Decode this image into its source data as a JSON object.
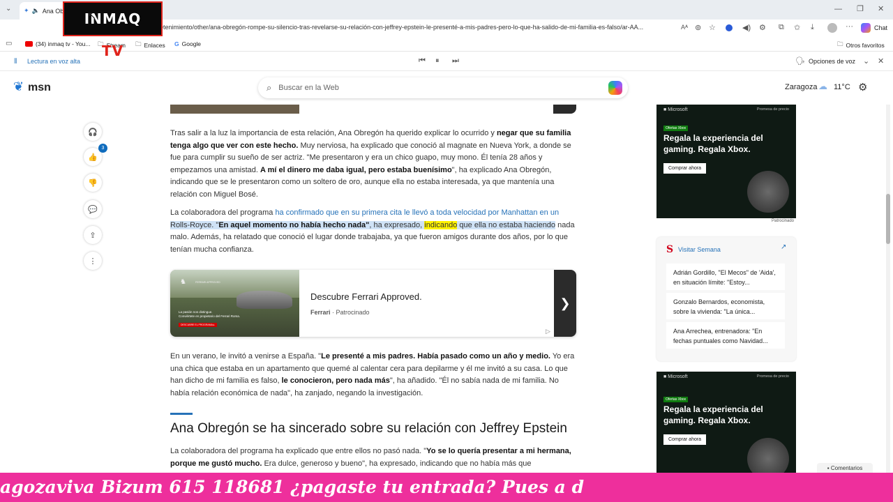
{
  "browser": {
    "tab_title": "Ana Obregón rompe su silencio",
    "url": "msn.com/es-es/entretenimiento/other/ana-obregón-rompe-su-silencio-tras-revelarse-su-relación-con-jeffrey-epstein-le-presenté-a-mis-padres-pero-lo-que-ha-salido-de-mi-familia-es-falso/ar-AA...",
    "chat_label": "Chat",
    "favorites": [
      {
        "icon": "youtube-icon",
        "label": "(34) inmaq tv - You..."
      },
      {
        "icon": "folder-icon",
        "label": "Stream"
      },
      {
        "icon": "folder-icon",
        "label": "Enlaces"
      },
      {
        "icon": "google-icon",
        "label": "Google"
      }
    ],
    "other_favorites": "Otros favoritos"
  },
  "reader": {
    "read_aloud": "Lectura en voz alta",
    "voice_options": "Opciones de voz"
  },
  "msn": {
    "logo": "msn",
    "search_placeholder": "Buscar en la Web",
    "city": "Zaragoza",
    "temp": "11°C"
  },
  "overlay": {
    "logo_a": "INMAQ ",
    "logo_b": "TV",
    "ticker": "agozaviva Bizum 615 118681                           ¿pagaste tu entrada? Pues a d"
  },
  "sidebar": {
    "like_count": "3"
  },
  "article": {
    "p1": [
      {
        "t": "Tras salir a la luz la importancia de esta relación, Ana Obregón ha querido explicar lo ocurrido y ",
        "s": "n"
      },
      {
        "t": "negar que su familia tenga algo que ver con este hecho.",
        "s": "b"
      },
      {
        "t": " Muy nerviosa, ha explicado que conoció al magnate en Nueva York, a donde se fue para cumplir su sueño de ser actriz. \"Me presentaron y era un chico guapo, muy mono. Él tenía 28 años y empezamos una amistad. ",
        "s": "n"
      },
      {
        "t": "A mí el dinero me daba igual, pero estaba buenísimo",
        "s": "b"
      },
      {
        "t": "\", ha explicado Ana Obregón, indicando que se le presentaron como un soltero de oro, aunque ella no estaba interesada, ya que mantenía una relación con Miguel Bosé.",
        "s": "n"
      }
    ],
    "p2": [
      {
        "t": "La colaboradora del programa ",
        "s": "n"
      },
      {
        "t": "ha confirmado que en su primera cita le llevó a toda velocidad por Manhattan en un ",
        "s": "l"
      },
      {
        "t": "Rolls-Royce. \"",
        "s": "h"
      },
      {
        "t": "En aquel momento no había hecho nada\"",
        "s": "hb"
      },
      {
        "t": ", ha expresado, ",
        "s": "h"
      },
      {
        "t": "indicando",
        "s": "y"
      },
      {
        "t": " que ella no estaba haciendo",
        "s": "h"
      },
      {
        "t": " nada malo. Además, ha relatado que conoció el lugar donde trabajaba, ya que fueron amigos durante dos años, por lo que tenían mucha confianza.",
        "s": "n"
      }
    ],
    "ad": {
      "title": "Descubre Ferrari Approved.",
      "brand": "Ferrari",
      "sponsored": "Patrocinado",
      "img_text_1": "La pasión nos distingue.",
      "img_text_2": "Conviértete en propietario del Ferrari Roma.",
      "img_cta": "DESCUBRE EL PROGRAMA ▸",
      "img_brand": "FERRARI APPROVED"
    },
    "p3": [
      {
        "t": "En un verano, le invitó a venirse a España. \"",
        "s": "n"
      },
      {
        "t": "Le presenté a mis padres. Había pasado como un año y medio.",
        "s": "b"
      },
      {
        "t": " Yo era una chica que estaba en un apartamento que quemé al calentar cera para depilarme y él me invitó a su casa. Lo que han dicho de mi familia es falso, ",
        "s": "n"
      },
      {
        "t": "le conocieron, pero nada más",
        "s": "b"
      },
      {
        "t": "\", ha añadido. \"Él no sabía nada de mi familia. No había relación económica de nada\", ha zanjado, negando la investigación.",
        "s": "n"
      }
    ],
    "heading": "Ana Obregón se ha sincerado sobre su relación con Jeffrey Epstein",
    "p4": [
      {
        "t": "La colaboradora del programa ha explicado que entre ellos no pasó nada. \"",
        "s": "n"
      },
      {
        "t": "Yo se lo quería presentar a mi hermana, porque me gustó mucho.",
        "s": "b"
      },
      {
        "t": " Era dulce, generoso y bueno\", ha expresado, indicando que no había más que",
        "s": "n"
      }
    ]
  },
  "right_rail": {
    "ad_brand": "Microsoft",
    "ad_promo": "Promesa de precio",
    "ad_offer": "Ofertas Xbox",
    "ad_headline": "Regala la experiencia del gaming. Regala Xbox.",
    "ad_button": "Comprar ahora",
    "sponsored": "Patrocinado",
    "semana_title": "Visitar Semana",
    "semana_items": [
      "Adrián Gordillo, \"El Mecos\" de 'Aida', en situación límite: \"Estoy...",
      "Gonzalo Bernardos, economista, sobre la vivienda: \"La única...",
      "Ana Arrechea, entrenadora: \"En fechas puntuales como Navidad..."
    ],
    "comments": "Comentarios"
  }
}
